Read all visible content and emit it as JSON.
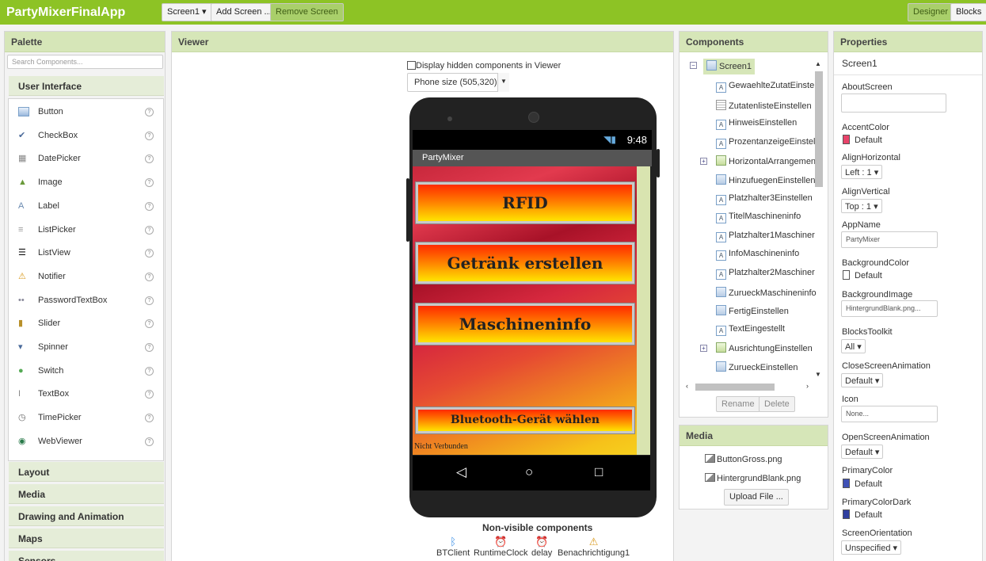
{
  "header": {
    "app_title": "PartyMixerFinalApp",
    "screen_dropdown": "Screen1 ▾",
    "add_screen": "Add Screen ...",
    "remove_screen": "Remove Screen",
    "designer": "Designer",
    "blocks": "Blocks"
  },
  "palette": {
    "title": "Palette",
    "search_placeholder": "Search Components...",
    "category_open": "User Interface",
    "items": [
      {
        "label": "Button",
        "icon": "button-icon"
      },
      {
        "label": "CheckBox",
        "icon": "checkbox-icon"
      },
      {
        "label": "DatePicker",
        "icon": "datepicker-icon"
      },
      {
        "label": "Image",
        "icon": "image-icon"
      },
      {
        "label": "Label",
        "icon": "label-icon"
      },
      {
        "label": "ListPicker",
        "icon": "listpicker-icon"
      },
      {
        "label": "ListView",
        "icon": "listview-icon"
      },
      {
        "label": "Notifier",
        "icon": "notifier-icon"
      },
      {
        "label": "PasswordTextBox",
        "icon": "passwordtextbox-icon"
      },
      {
        "label": "Slider",
        "icon": "slider-icon"
      },
      {
        "label": "Spinner",
        "icon": "spinner-icon"
      },
      {
        "label": "Switch",
        "icon": "switch-icon"
      },
      {
        "label": "TextBox",
        "icon": "textbox-icon"
      },
      {
        "label": "TimePicker",
        "icon": "timepicker-icon"
      },
      {
        "label": "WebViewer",
        "icon": "webviewer-icon"
      }
    ],
    "help_glyph": "?",
    "categories": [
      "Layout",
      "Media",
      "Drawing and Animation",
      "Maps",
      "Sensors"
    ]
  },
  "viewer": {
    "title": "Viewer",
    "hidden_components_label": "Display hidden components in Viewer",
    "phone_size": "Phone size (505,320)",
    "status_time": "9:48",
    "app_bar_title": "PartyMixer",
    "buttons": [
      "RFID",
      "Getränk erstellen",
      "Maschineninfo",
      "Bluetooth-Gerät wählen"
    ],
    "status_label": "Nicht Verbunden",
    "non_visible_title": "Non-visible components",
    "non_visible": [
      "BTClient",
      "RuntimeClock",
      "delay",
      "Benachrichtigung1"
    ]
  },
  "components": {
    "title": "Components",
    "root": "Screen1",
    "items": [
      "GewaehlteZutatEinstel",
      "ZutatenlisteEinstellen",
      "HinweisEinstellen",
      "ProzentanzeigeEinstell",
      "HorizontalArrangemen",
      "HinzufuegenEinstellen",
      "Platzhalter3Einstellen",
      "TitelMaschineninfo",
      "Platzhalter1Maschiner",
      "InfoMaschineninfo",
      "Platzhalter2Maschiner",
      "ZurueckMaschineninfo",
      "FertigEinstellen",
      "TextEingestellt",
      "AusrichtungEinstellen",
      "ZurueckEinstellen"
    ],
    "rename": "Rename",
    "delete": "Delete"
  },
  "media": {
    "title": "Media",
    "files": [
      "ButtonGross.png",
      "HintergrundBlank.png"
    ],
    "upload": "Upload File ..."
  },
  "properties": {
    "title": "Properties",
    "screen": "Screen1",
    "about_label": "AboutScreen",
    "accent_label": "AccentColor",
    "accent_value": "Default",
    "accent_color": "#e8436a",
    "alignh_label": "AlignHorizontal",
    "alignh_value": "Left : 1 ▾",
    "alignv_label": "AlignVertical",
    "alignv_value": "Top : 1 ▾",
    "appname_label": "AppName",
    "appname_value": "PartyMixer",
    "bgcolor_label": "BackgroundColor",
    "bgcolor_value": "Default",
    "bgimage_label": "BackgroundImage",
    "bgimage_value": "HintergrundBlank.png...",
    "blockstoolkit_label": "BlocksToolkit",
    "blockstoolkit_value": "All ▾",
    "closeanim_label": "CloseScreenAnimation",
    "closeanim_value": "Default ▾",
    "icon_label": "Icon",
    "icon_value": "None...",
    "openanim_label": "OpenScreenAnimation",
    "openanim_value": "Default ▾",
    "primary_label": "PrimaryColor",
    "primary_value": "Default",
    "primary_color": "#3f51b5",
    "primarydark_label": "PrimaryColorDark",
    "primarydark_value": "Default",
    "primarydark_color": "#303f9f",
    "orientation_label": "ScreenOrientation",
    "orientation_value": "Unspecified ▾"
  }
}
